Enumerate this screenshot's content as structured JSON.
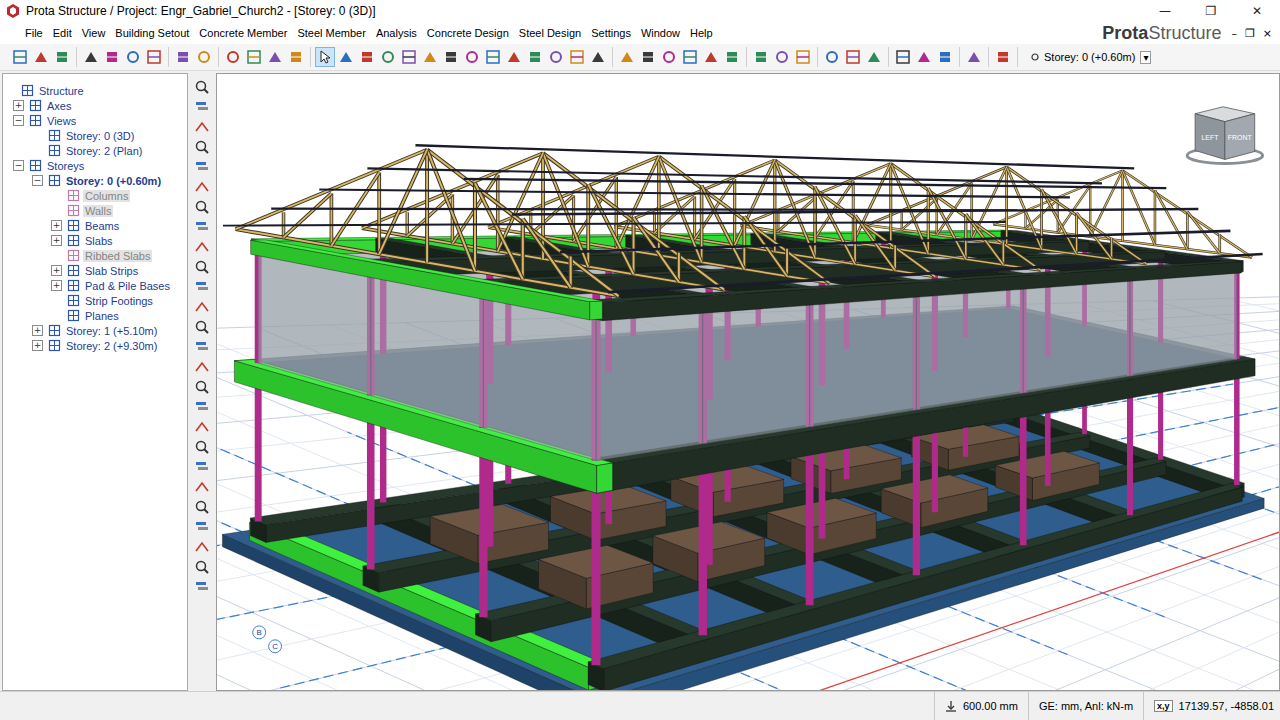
{
  "window": {
    "title": "Prota Structure / Project: Engr_Gabriel_Church2 - [Storey: 0 (3D)]",
    "controls": [
      "—",
      "❐",
      "✕"
    ]
  },
  "menu": [
    "File",
    "Edit",
    "View",
    "Building Setout",
    "Concrete Member",
    "Steel Member",
    "Analysis",
    "Concrete Design",
    "Steel Design",
    "Settings",
    "Window",
    "Help"
  ],
  "brand": {
    "bold": "Prota",
    "light": "Structure"
  },
  "mdi_controls": [
    "–",
    "❐",
    "×"
  ],
  "toolbar": {
    "groups": [
      [
        {
          "selected": false
        },
        {
          "selected": false
        },
        {
          "selected": false
        }
      ],
      [
        {
          "selected": false
        },
        {
          "selected": false
        },
        {
          "selected": false
        },
        {
          "selected": false
        }
      ],
      [
        {
          "selected": false
        },
        {
          "selected": false
        }
      ],
      [
        {
          "selected": false
        },
        {
          "selected": false
        },
        {
          "selected": false
        },
        {
          "selected": false
        }
      ],
      [
        {
          "selected": true
        },
        {
          "selected": false
        },
        {
          "selected": false
        },
        {
          "selected": false
        },
        {
          "selected": false
        },
        {
          "selected": false
        },
        {
          "selected": false
        },
        {
          "selected": false
        },
        {
          "selected": false
        },
        {
          "selected": false
        },
        {
          "selected": false
        },
        {
          "selected": false
        },
        {
          "selected": false
        },
        {
          "selected": false
        }
      ],
      [
        {
          "selected": false
        },
        {
          "selected": false
        },
        {
          "selected": false
        },
        {
          "selected": false
        },
        {
          "selected": false
        },
        {
          "selected": false
        }
      ],
      [
        {
          "selected": false
        },
        {
          "selected": false
        },
        {
          "selected": false
        }
      ],
      [
        {
          "selected": false
        },
        {
          "selected": false
        },
        {
          "selected": false
        }
      ],
      [
        {
          "selected": false
        },
        {
          "selected": false
        },
        {
          "selected": false
        }
      ],
      [
        {
          "selected": false
        }
      ],
      [
        {
          "selected": false
        }
      ]
    ]
  },
  "storey_select": {
    "value": "Storey: 0 (+0.60m)",
    "arrow": "▾"
  },
  "tree": [
    {
      "label": "Structure",
      "depth": 0,
      "expander": "",
      "disabled": false,
      "selected": false
    },
    {
      "label": "Axes",
      "depth": 1,
      "expander": "+",
      "disabled": false,
      "selected": false
    },
    {
      "label": "Views",
      "depth": 1,
      "expander": "−",
      "disabled": false,
      "selected": false
    },
    {
      "label": "Storey: 0 (3D)",
      "depth": 2,
      "expander": "",
      "disabled": false,
      "selected": false
    },
    {
      "label": "Storey: 2 (Plan)",
      "depth": 2,
      "expander": "",
      "disabled": false,
      "selected": false
    },
    {
      "label": "Storeys",
      "depth": 1,
      "expander": "−",
      "disabled": false,
      "selected": false
    },
    {
      "label": "Storey: 0 (+0.60m)",
      "depth": 2,
      "expander": "−",
      "disabled": false,
      "selected": true
    },
    {
      "label": "Columns",
      "depth": 3,
      "expander": "",
      "disabled": true,
      "selected": false
    },
    {
      "label": "Walls",
      "depth": 3,
      "expander": "",
      "disabled": true,
      "selected": false
    },
    {
      "label": "Beams",
      "depth": 3,
      "expander": "+",
      "disabled": false,
      "selected": false
    },
    {
      "label": "Slabs",
      "depth": 3,
      "expander": "+",
      "disabled": false,
      "selected": false
    },
    {
      "label": "Ribbed Slabs",
      "depth": 3,
      "expander": "",
      "disabled": true,
      "selected": false
    },
    {
      "label": "Slab Strips",
      "depth": 3,
      "expander": "+",
      "disabled": false,
      "selected": false
    },
    {
      "label": "Pad & Pile Bases",
      "depth": 3,
      "expander": "+",
      "disabled": false,
      "selected": false
    },
    {
      "label": "Strip Footings",
      "depth": 3,
      "expander": "",
      "disabled": false,
      "selected": false
    },
    {
      "label": "Planes",
      "depth": 3,
      "expander": "",
      "disabled": false,
      "selected": false
    },
    {
      "label": "Storey: 1 (+5.10m)",
      "depth": 2,
      "expander": "+",
      "disabled": false,
      "selected": false
    },
    {
      "label": "Storey: 2 (+9.30m)",
      "depth": 2,
      "expander": "+",
      "disabled": false,
      "selected": false
    }
  ],
  "view_cube": {
    "left": "LEFT",
    "front": "FRONT"
  },
  "axis_bubbles": [
    "B",
    "C"
  ],
  "status_bar": {
    "elevation": "600.00 mm",
    "units": "GE: mm, Anl: kN-m",
    "coord_label": "x,y",
    "coords": "17139.57, -4858.01"
  }
}
